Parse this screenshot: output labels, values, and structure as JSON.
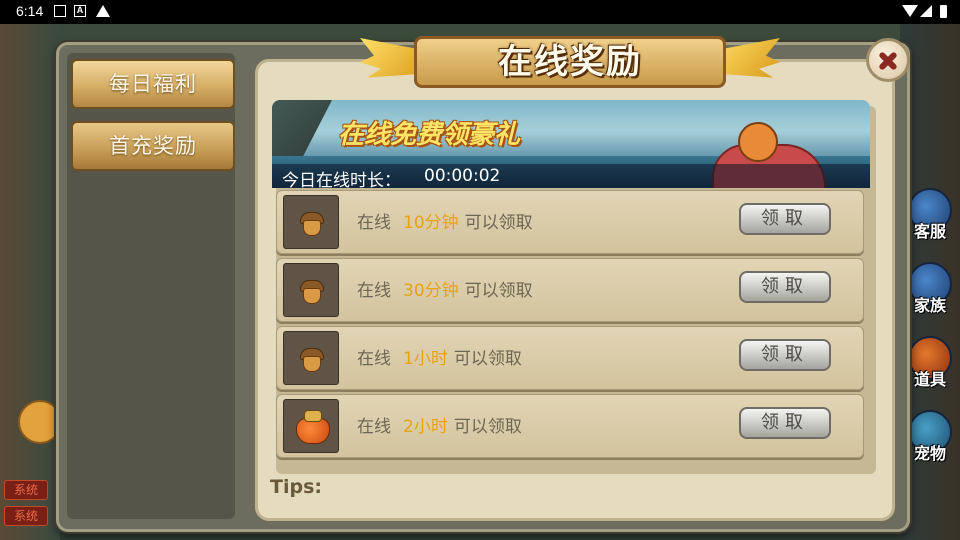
{
  "status_bar": {
    "time": "6:14"
  },
  "background": {
    "chat_tags": [
      "系统",
      "系统"
    ],
    "side_buttons": [
      "客服",
      "家族",
      "道具",
      "宠物"
    ]
  },
  "dialog": {
    "title": "在线奖励",
    "tabs": [
      {
        "label": "每日福利",
        "active": true
      },
      {
        "label": "首充奖励",
        "active": false
      }
    ],
    "banner": {
      "headline": "在线免费领豪礼",
      "online_time_label": "今日在线时长：",
      "online_time_value": "00:00:02"
    },
    "rewards": [
      {
        "prefix": "在线",
        "duration": "10分钟",
        "suffix": "可以领取",
        "button": "领取",
        "icon": "acorn-icon"
      },
      {
        "prefix": "在线",
        "duration": "30分钟",
        "suffix": "可以领取",
        "button": "领取",
        "icon": "acorn-icon"
      },
      {
        "prefix": "在线",
        "duration": "1小时",
        "suffix": "可以领取",
        "button": "领取",
        "icon": "acorn-icon"
      },
      {
        "prefix": "在线",
        "duration": "2小时",
        "suffix": "可以领取",
        "button": "领取",
        "icon": "money-bag-icon"
      }
    ],
    "tips_label": "Tips:"
  },
  "colors": {
    "accent_gold": "#e6a312",
    "banner_headline": "#ffe566",
    "close_x": "#8a2a22"
  }
}
